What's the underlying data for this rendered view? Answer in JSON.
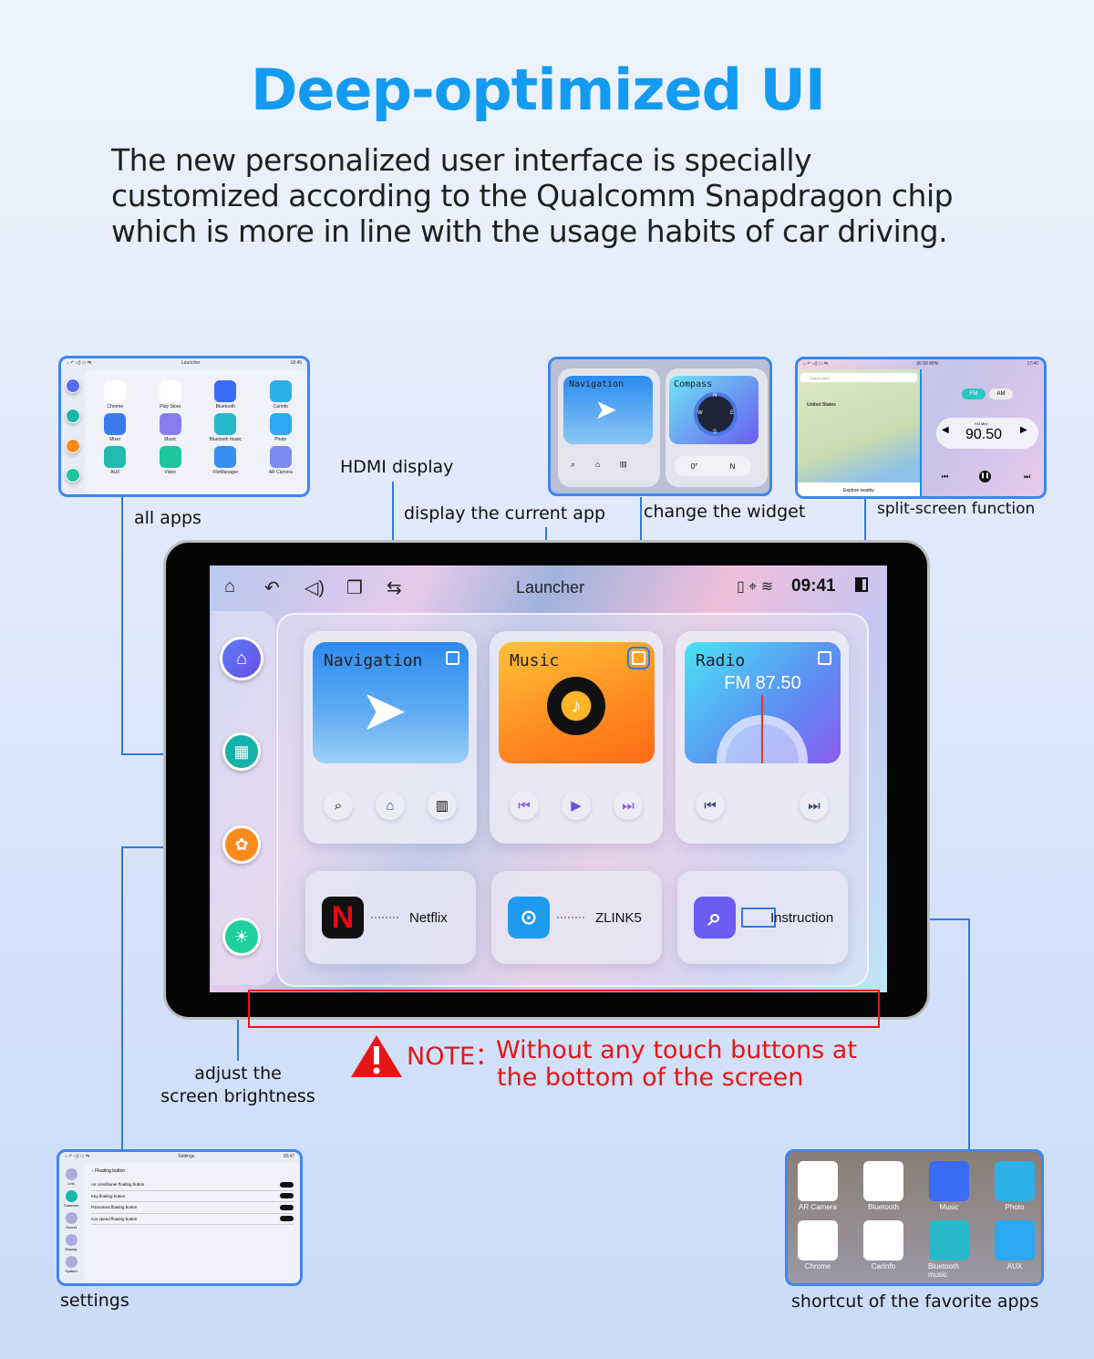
{
  "title": "Deep-optimized UI",
  "description": "The new personalized user interface is specially customized according to the Qualcomm Snapdragon chip which is more in line with the usage habits of car driving.",
  "colors": {
    "accent": "#139bf2",
    "connector": "#2f7ce6",
    "note": "#e51616"
  },
  "labels": {
    "all_apps": "all apps",
    "hdmi": "HDMI display",
    "current_app": "display the current app",
    "widget": "change the widget",
    "split": "split-screen function",
    "brightness_1": "adjust the",
    "brightness_2": "screen brightness",
    "settings": "settings",
    "shortcut": "shortcut of the favorite apps"
  },
  "note": {
    "prefix": "NOTE：",
    "line1": "Without any touch buttons at",
    "line2": "the bottom of the screen",
    "icon": "warning-icon"
  },
  "screen": {
    "status": {
      "title": "Launcher",
      "time": "09:41"
    },
    "widgets": [
      {
        "title": "Navigation",
        "buttons": [
          "search-icon",
          "home-icon",
          "building-icon"
        ]
      },
      {
        "title": "Music",
        "buttons": [
          "previous-icon",
          "play-icon",
          "next-icon"
        ]
      },
      {
        "title": "Radio",
        "freq": "FM 87.50",
        "buttons": [
          "previous-icon",
          "next-icon"
        ]
      }
    ],
    "apps": [
      {
        "name": "Netflix",
        "letter": "N"
      },
      {
        "name": "ZLINK5"
      },
      {
        "name": "Instruction"
      }
    ]
  },
  "thumb_all_apps": {
    "title": "Launcher",
    "time": "18:45",
    "apps": [
      "Chrome",
      "Play Store",
      "Bluetooth",
      "CarInfo",
      "Mixer",
      "Music",
      "Bluetooth music",
      "Photo",
      "AUX",
      "Video",
      "FileManager",
      "AR Camera"
    ]
  },
  "thumb_widget": {
    "nav": "Navigation",
    "compass": "Compass",
    "deg": "0°",
    "dir": "N",
    "points": [
      "N",
      "E",
      "S",
      "W"
    ]
  },
  "thumb_split": {
    "freq_title": "90.50 MHz",
    "time": "17:40",
    "search": "Search here",
    "country": "United States",
    "explore": "Explore nearby",
    "fm": "FM",
    "am": "AM",
    "band": "FM",
    "unit": "Mhz",
    "freq": "90.50"
  },
  "thumb_settings": {
    "title": "Settings",
    "time": "18:47",
    "header": "Floating button",
    "items": [
      "Air conditioner floating button",
      "Key floating button",
      "Panorama floating button",
      "Car speed floating button"
    ],
    "side": [
      "Link",
      "Common",
      "Sound",
      "Display",
      "System"
    ]
  },
  "thumb_shortcut": {
    "apps": [
      "AR Camera",
      "Bluetooth",
      "Music",
      "Photo",
      "Chrome",
      "CarInfo",
      "Bluetooth music",
      "AUX"
    ]
  }
}
